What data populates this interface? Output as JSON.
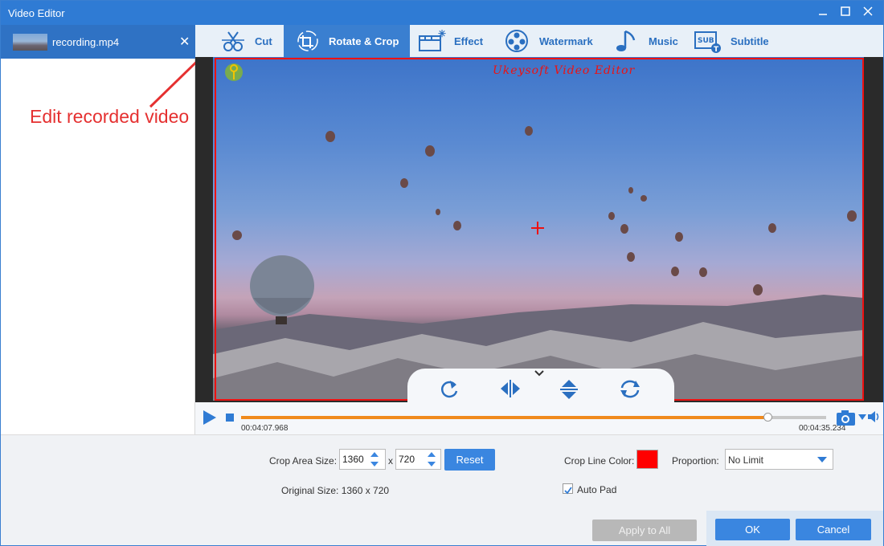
{
  "window": {
    "title": "Video Editor"
  },
  "sidebar": {
    "file_name": "recording.mp4"
  },
  "annotation": {
    "text": "Edit recorded video"
  },
  "tabs": [
    {
      "label": "Cut",
      "icon": "cut-icon",
      "active": false
    },
    {
      "label": "Rotate & Crop",
      "icon": "rotate-crop-icon",
      "active": true
    },
    {
      "label": "Effect",
      "icon": "effect-icon",
      "active": false
    },
    {
      "label": "Watermark",
      "icon": "watermark-icon",
      "active": false
    },
    {
      "label": "Music",
      "icon": "music-icon",
      "active": false
    },
    {
      "label": "Subtitle",
      "icon": "subtitle-icon",
      "active": false
    }
  ],
  "preview": {
    "watermark_text": "Ukeysoft Video Editor"
  },
  "playback": {
    "current_time": "00:04:07.968",
    "total_time": "00:04:35.234",
    "progress": 0.9
  },
  "crop": {
    "area_label": "Crop Area Size:",
    "width": "1360",
    "separator": "x",
    "height": "720",
    "reset_label": "Reset",
    "original_label": "Original Size: 1360 x 720",
    "line_color_label": "Crop Line Color:",
    "line_color": "#ff0000",
    "proportion_label": "Proportion:",
    "proportion_value": "No Limit",
    "auto_pad_label": "Auto Pad",
    "auto_pad_checked": true
  },
  "footer": {
    "apply_all_label": "Apply to All",
    "ok_label": "OK",
    "cancel_label": "Cancel"
  },
  "colors": {
    "accent": "#2f7bd4",
    "crop_red": "#ee1111",
    "progress": "#f08a1c"
  }
}
